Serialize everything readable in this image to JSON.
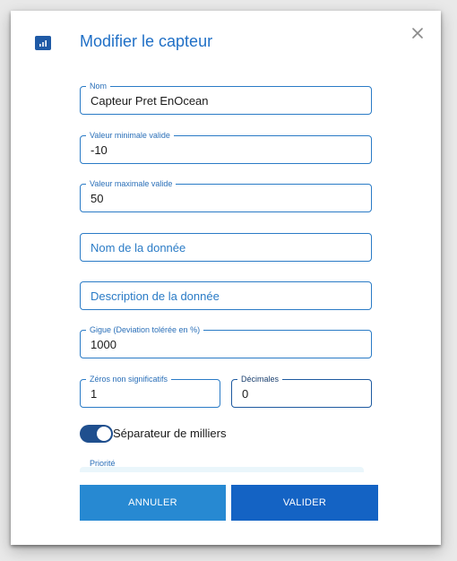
{
  "header": {
    "title": "Modifier le capteur",
    "icon": "chart-bar-icon",
    "close_icon": "close-icon"
  },
  "fields": {
    "nom": {
      "label": "Nom",
      "value": "Capteur Pret EnOcean"
    },
    "valeur_min": {
      "label": "Valeur minimale valide",
      "value": "-10"
    },
    "valeur_max": {
      "label": "Valeur maximale valide",
      "value": "50"
    },
    "nom_donnee": {
      "placeholder": "Nom de la donnée"
    },
    "description_donnee": {
      "placeholder": "Description de la donnée"
    },
    "gigue": {
      "label": "Gigue (Deviation tolérée en %)",
      "value": "1000"
    },
    "zeros": {
      "label": "Zéros non significatifs",
      "value": "1"
    },
    "decimales": {
      "label": "Décimales",
      "value": "0"
    }
  },
  "toggle": {
    "label": "Séparateur de milliers",
    "checked": true
  },
  "priorite": {
    "label": "Priorité"
  },
  "buttons": {
    "cancel": "ANNULER",
    "ok": "VALIDER"
  },
  "colors": {
    "accent": "#1f6fc6",
    "border": "#2a7bc6",
    "toggle_on": "#1f4f8e",
    "cancel_button": "#2789d2",
    "ok_button": "#1463c4"
  }
}
